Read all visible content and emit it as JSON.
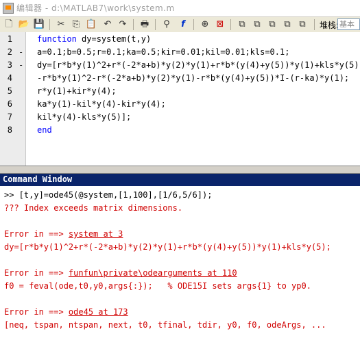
{
  "window": {
    "title": "编辑器 - d:\\MATLAB7\\work\\system.m"
  },
  "toolbar": {
    "stack_label": "堆栈:",
    "stack_value": "基本"
  },
  "editor": {
    "lines": [
      {
        "num": "1",
        "dash": "",
        "kw": "function",
        "text": " dy=system(t,y)"
      },
      {
        "num": "2",
        "dash": "-",
        "kw": "",
        "text": "a=0.1;b=0.5;r=0.1;ka=0.5;kir=0.01;kil=0.01;kls=0.1;"
      },
      {
        "num": "3",
        "dash": "-",
        "kw": "",
        "text": "dy=[r*b*y(1)^2+r*(-2*a+b)*y(2)*y(1)+r*b*(y(4)+y(5))*y(1)+kls*y(5);"
      },
      {
        "num": "4",
        "dash": "",
        "kw": "",
        "text": "-r*b*y(1)^2-r*(-2*a+b)*y(2)*y(1)-r*b*(y(4)+y(5))*I-(r-ka)*y(1);"
      },
      {
        "num": "5",
        "dash": "",
        "kw": "",
        "text": "r*y(1)+kir*y(4);"
      },
      {
        "num": "6",
        "dash": "",
        "kw": "",
        "text": "ka*y(1)-kil*y(4)-kir*y(4);"
      },
      {
        "num": "7",
        "dash": "",
        "kw": "",
        "text": "kil*y(4)-kls*y(5)];"
      },
      {
        "num": "8",
        "dash": "",
        "kw": "end",
        "text": ""
      }
    ]
  },
  "command_window": {
    "title": "Command Window",
    "prompt": ">> [t,y]=ode45(@system,[1,100],[1/6,5/6]);",
    "error1": "??? Index exceeds matrix dimensions.",
    "err_in_1_prefix": "Error in ==> ",
    "err_in_1_link": "system at 3",
    "err_line_1": "dy=[r*b*y(1)^2+r*(-2*a+b)*y(2)*y(1)+r*b*(y(4)+y(5))*y(1)+kls*y(5);",
    "err_in_2_prefix": "Error in ==> ",
    "err_in_2_link": "funfun\\private\\odearguments at 110",
    "err_line_2": "f0 = feval(ode,t0,y0,args{:});   % ODE15I sets args{1} to yp0.",
    "err_in_3_prefix": "Error in ==> ",
    "err_in_3_link": "ode45 at 173",
    "err_line_3": "[neq, tspan, ntspan, next, t0, tfinal, tdir, y0, f0, odeArgs, ..."
  }
}
